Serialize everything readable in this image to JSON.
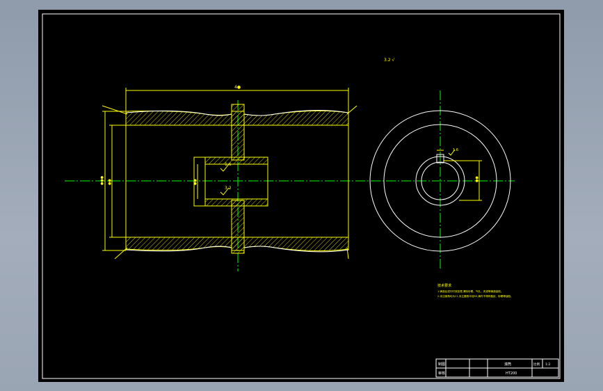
{
  "drawing": {
    "top_note": "3.2 √",
    "dim_overall_length": "4●",
    "dim_outer_dia": "●●●",
    "dim_inner_dia": "●●",
    "dim_hub_bore": "●●",
    "dim_keyway": "●●",
    "roughness_hub": "1.6",
    "roughness_bore": "3.2",
    "roughness_small": "1.6",
    "tech_title": "技术要求",
    "tech_line1": "1.铸造后进行时效处理,清除砂眼、气孔、夹渣等铸造缺陷。",
    "tech_line2": "2.未注倒角均为C1,未注圆角半径R3,铸件不得有裂纹、砂眼等缺陷。"
  },
  "title_block": {
    "label_draw": "制图",
    "label_check": "审核",
    "part_name": "滚筒",
    "scale_label": "比例",
    "scale_value": "1:2",
    "material": "HT200"
  }
}
